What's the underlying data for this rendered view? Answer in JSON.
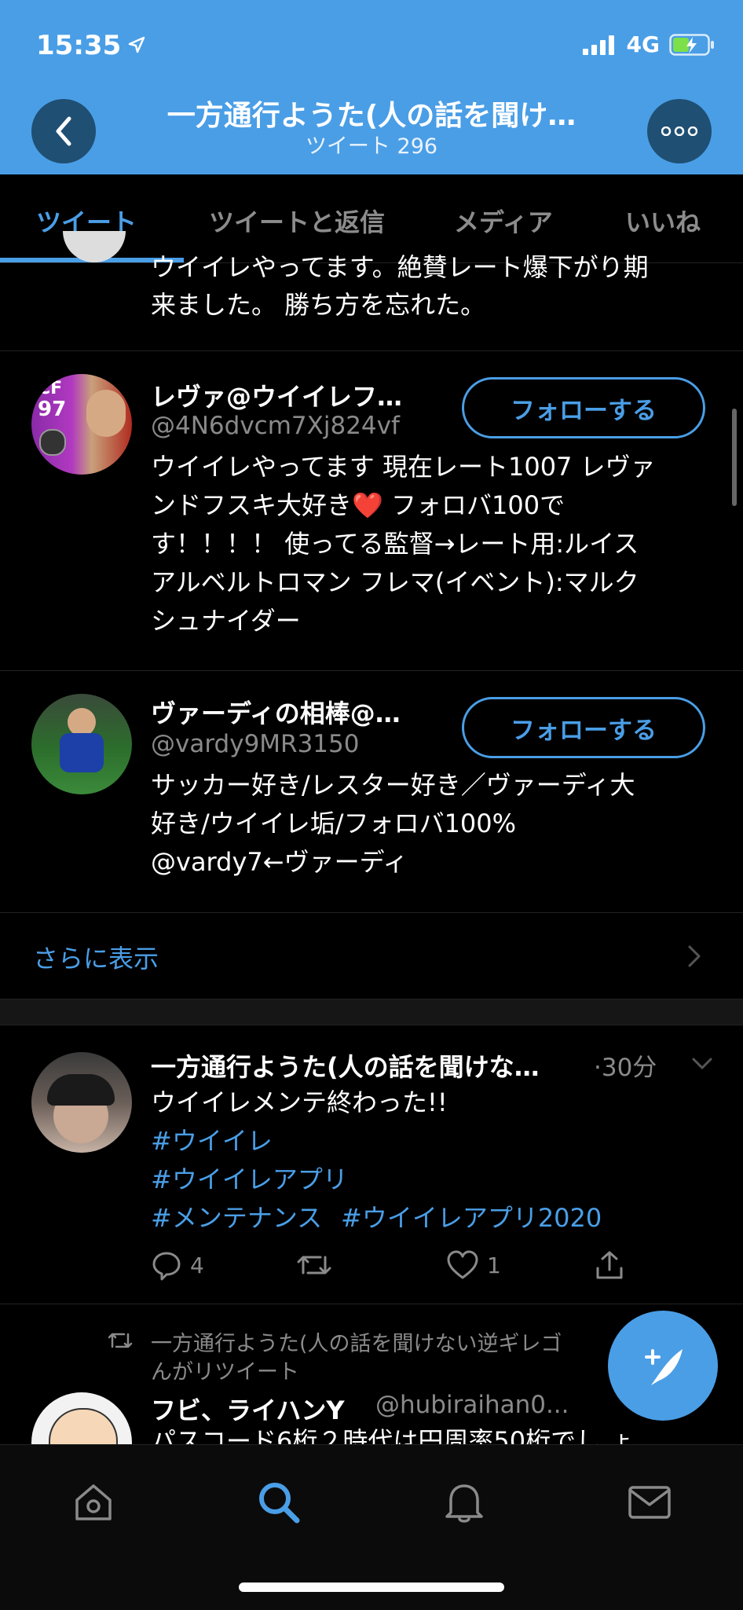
{
  "status_bar": {
    "time": "15:35",
    "network": "4G"
  },
  "header": {
    "title": "一方通行ようた(人の話を聞け…",
    "subtitle": "ツイート 296"
  },
  "tabs": [
    {
      "label": "ツイート",
      "active": true
    },
    {
      "label": "ツイートと返信",
      "active": false
    },
    {
      "label": "メディア",
      "active": false
    },
    {
      "label": "いいね",
      "active": false
    }
  ],
  "prev_item": {
    "line1": "ウイイレやってます。絶賛レート爆下がり期",
    "line2": "来ました。 勝ち方を忘れた。"
  },
  "users": [
    {
      "name": "レヴァ@ウイイレフ…",
      "handle": "@4N6dvcm7Xj824vf",
      "follow_label": "フォローする",
      "bio_lines": [
        "ウイイレやってます 現在レート1007 レヴァ",
        "ンドフスキ大好き❤️ フォロバ100で",
        "す！！！！ 使ってる監督→レート用:ルイス",
        "アルベルトロマン フレマ(イベント):マルク",
        "シュナイダー"
      ],
      "avatar_badge": {
        "pos": "CF",
        "rating": "97"
      }
    },
    {
      "name": "ヴァーディの相棒@…",
      "handle": "@vardy9MR3150",
      "follow_label": "フォローする",
      "bio_lines": [
        "サッカー好き/レスター好き／ヴァーディ大",
        "好き/ウイイレ垢/フォロバ100%",
        "@vardy7←ヴァーディ"
      ]
    }
  ],
  "show_more": {
    "label": "さらに表示"
  },
  "tweet": {
    "author": "一方通行ようた(人の話を聞けな…",
    "time": "·30分",
    "text": "ウイイレメンテ終わった!!",
    "hashtags": [
      "#ウイイレ",
      "#ウイイレアプリ",
      "#メンテナンス",
      "#ウイイレアプリ2020"
    ],
    "reply_count": "4",
    "like_count": "1"
  },
  "retweet": {
    "context_line1": "一方通行ようた(人の話を聞けない逆ギレゴ",
    "context_line2": "んがリツイート",
    "author": "フビ、ライハンY",
    "handle": "@hubiraihan0...",
    "text_partial": "パスコード6桁２時代は円周率50桁でし ょ"
  },
  "colors": {
    "accent": "#4a9ee6",
    "header_bg": "#4a9ee6",
    "background": "#000000",
    "muted": "#8a8a8a"
  },
  "icons": [
    "back-arrow-icon",
    "more-dots-icon",
    "reply-icon",
    "retweet-icon",
    "like-icon",
    "share-icon",
    "compose-icon",
    "home-icon",
    "search-icon",
    "notifications-icon",
    "messages-icon"
  ]
}
